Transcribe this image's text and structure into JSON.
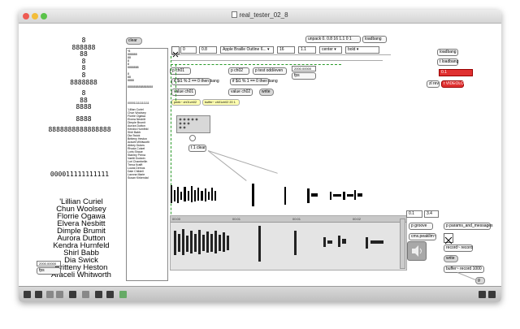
{
  "window": {
    "title": "real_tester_02_8"
  },
  "left_numbers": [
    "8",
    "888888",
    "88",
    "8",
    "8",
    "8",
    "8888888",
    "8",
    "88",
    "8888",
    "8888",
    "8888888888888888",
    "000011111111111"
  ],
  "names": [
    "'Lillian Curiel",
    "Chun Woolsey",
    "Florrie Ogawa",
    "Elvera Nesbitt",
    "Dimple Brumit",
    "Aurora Dutton",
    "Kendra Hurnfeld",
    "Shirl Babb",
    "Dia Swick",
    "Britteny Heston",
    "Araceli Whitworth"
  ],
  "listbox": {
    "lines": [
      "*8",
      "888888",
      "88",
      "8",
      "8",
      "8888888",
      "",
      "8",
      "88",
      "8888",
      "",
      "8888888888888888",
      "",
      "",
      "",
      "",
      "000011111111111",
      "",
      "'Lillian Curiel",
      "Chun Woolsey",
      "Florrie Ogawa",
      "Elvera Nesbitt",
      "Dimple Brumit",
      "Aurora Dutton",
      "Kendra Hurnfeld",
      "Shirl Babb",
      "Dia Swick",
      "Britteny Heston",
      "Araceli Whitworth",
      "Abbey Dukes",
      "Rhoda Cotzel",
      "Loris Shaue",
      "Stanley Prena",
      "Vaetti Godwin",
      "Lori Chambellin",
      "Trena Krafft",
      "Lucas Demos",
      "Dale Childell",
      "Lavona Marie",
      "Susan Kirkendal"
    ]
  },
  "toolbar_objects": {
    "clear_label": "clear",
    "val1": "0",
    "val2": "0.8",
    "font_menu": "Apple Braille Outline 6...",
    "val3": "16",
    "val4": "1.1",
    "align_menu": "center",
    "style_menu": "bold",
    "unpack": "unpack 0. 0.8 16 1.1 0 1",
    "loadbang_small": "loadbang"
  },
  "patch": {
    "p_ch01": "p ch01",
    "p_ch02": "p ch02",
    "p_test": "p test odd/even",
    "value_ch01": "value ch01",
    "value_ch02": "value ch02",
    "write": "write",
    "expr1": "if $i1 % 2 == 0 then bang",
    "expr2": "if $i1 % 1 == 0 then bang",
    "peek": "peek~ ch01ch02",
    "buffer": "buffer~ ch01ch02 20 1",
    "fps_top": "fps",
    "fps_val_top": "2000.00000",
    "t_clear": "t 1 clear",
    "fps_bottom": "fps",
    "fps_val_bottom": "2000.00000"
  },
  "right_objects": {
    "loadbang": "loadbang",
    "t_loadbang": "t loadbang",
    "red_num": "0.1",
    "zl_rev": "zl rev",
    "t_video": "t VIDEOLOM"
  },
  "audio": {
    "range_low": "0.1",
    "range_high": "3.4",
    "p_groove": "p groove",
    "p_params": "p params_and_messages",
    "peakamp": "cmx.peakllm~",
    "record": "record~ record",
    "write": "write",
    "buffer": "buffer~ record 1000",
    "dac_label": "g",
    "timeline": [
      "00:00",
      "00:01",
      "00:01",
      "00:02"
    ]
  },
  "colors": {
    "accent_green": "#2a9a2a",
    "accent_red": "#e03030",
    "yellow_obj": "#ffffb0"
  }
}
